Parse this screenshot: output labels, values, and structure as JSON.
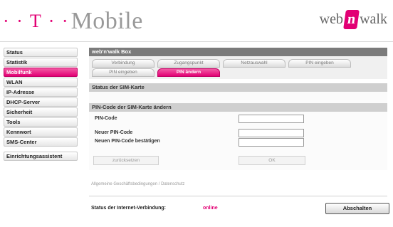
{
  "header": {
    "brand_text": "Mobile",
    "brand_prefix": "· · T · ·",
    "logo_left": "web",
    "logo_mid": "n",
    "logo_right": "walk",
    "accent": "#e20074"
  },
  "menu": {
    "items": [
      {
        "label": "Status"
      },
      {
        "label": "Statistik"
      },
      {
        "label": "Mobilfunk",
        "active": true
      },
      {
        "label": "WLAN"
      },
      {
        "label": "IP-Adresse"
      },
      {
        "label": "DHCP-Server"
      },
      {
        "label": "Sicherheit"
      },
      {
        "label": "Tools"
      },
      {
        "label": "Kennwort"
      },
      {
        "label": "SMS-Center"
      }
    ],
    "assistant": "Einrichtungsassistent"
  },
  "panel": {
    "title": "web'n'walk Box",
    "tabs": [
      {
        "label": "Verbindung"
      },
      {
        "label": "Zugangspunkt"
      },
      {
        "label": "Netzauswahl"
      },
      {
        "label": "PIN eingeben"
      },
      {
        "label": "PIN eingeben"
      },
      {
        "label": "PIN ändern",
        "active": true
      }
    ],
    "sim_status_heading": "Status der SIM-Karte",
    "change_pin_heading": "PIN-Code der SIM-Karte ändern",
    "fields": {
      "pin_label": "PIN-Code",
      "new_pin_label": "Neuer PIN-Code",
      "confirm_pin_label": "Neuen PIN-Code bestätigen",
      "pin_value": "",
      "new_pin_value": "",
      "confirm_pin_value": ""
    },
    "reset_label": "zurücksetzen",
    "ok_label": "OK"
  },
  "footer": {
    "links": "Allgemeine Geschäftsbedingungen / Datenschutz",
    "status_label": "Status der Internet-Verbindung:",
    "status_value": "online",
    "disconnect_label": "Abschalten"
  }
}
